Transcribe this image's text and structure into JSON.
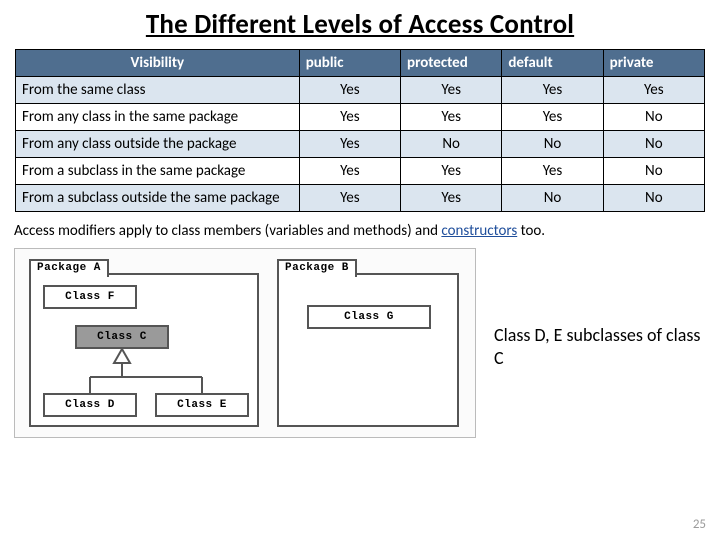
{
  "title": "The Different Levels of Access Control",
  "table": {
    "header": {
      "visibility": "Visibility",
      "cols": [
        "public",
        "protected",
        "default",
        "private"
      ]
    },
    "rows": [
      {
        "label": "From the same class",
        "vals": [
          "Yes",
          "Yes",
          "Yes",
          "Yes"
        ],
        "alt": true
      },
      {
        "label": "From any class in the same package",
        "vals": [
          "Yes",
          "Yes",
          "Yes",
          "No"
        ],
        "alt": false
      },
      {
        "label": "From any class  outside the package",
        "vals": [
          "Yes",
          "No",
          "No",
          "No"
        ],
        "alt": true
      },
      {
        "label": "From a subclass in  the same package",
        "vals": [
          "Yes",
          "Yes",
          "Yes",
          "No"
        ],
        "alt": false
      },
      {
        "label": "From a subclass  outside the same package",
        "vals": [
          "Yes",
          "Yes",
          "No",
          "No"
        ],
        "alt": true
      }
    ]
  },
  "note": {
    "prefix": "Access modifiers apply to  class members (variables and methods) and ",
    "accent": "constructors",
    "suffix": " too."
  },
  "diagram": {
    "pkgA": "Package A",
    "pkgB": "Package B",
    "classF": "Class F",
    "classC": "Class C",
    "classD": "Class D",
    "classE": "Class E",
    "classG": "Class G",
    "caption": "Class D, E subclasses of class C"
  },
  "page_number": "25",
  "chart_data": {
    "type": "table",
    "title": "The Different Levels of Access Control",
    "columns": [
      "Visibility",
      "public",
      "protected",
      "default",
      "private"
    ],
    "rows": [
      [
        "From the same class",
        "Yes",
        "Yes",
        "Yes",
        "Yes"
      ],
      [
        "From any class in the same package",
        "Yes",
        "Yes",
        "Yes",
        "No"
      ],
      [
        "From any class outside the package",
        "Yes",
        "No",
        "No",
        "No"
      ],
      [
        "From a subclass in the same package",
        "Yes",
        "Yes",
        "Yes",
        "No"
      ],
      [
        "From a subclass outside the same package",
        "Yes",
        "Yes",
        "No",
        "No"
      ]
    ]
  }
}
